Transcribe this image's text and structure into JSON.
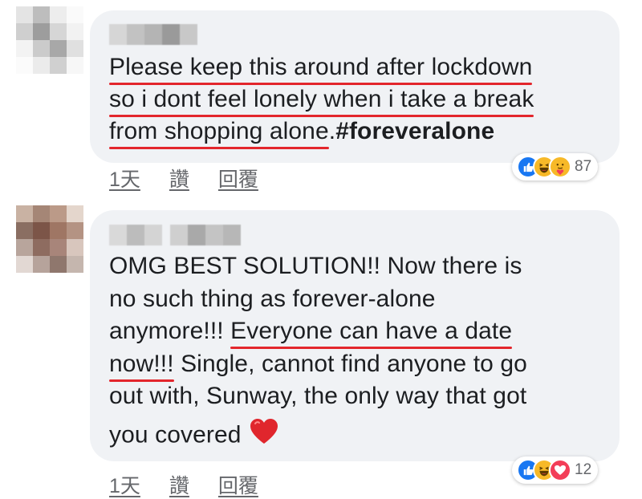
{
  "comments": [
    {
      "lines": [
        [
          {
            "text": "Please keep this around after lockdown",
            "u": true
          }
        ],
        [
          {
            "text": "so i dont feel lonely when i take a break",
            "u": true
          }
        ],
        [
          {
            "text": "from shopping alone",
            "u": true
          },
          {
            "text": ".",
            "u": false
          },
          {
            "text": "#foreveralone",
            "u": false,
            "tag": true
          }
        ]
      ],
      "actions": {
        "time": "1天",
        "like": "讚",
        "reply": "回覆"
      },
      "reactions": {
        "icons": [
          "like-icon",
          "haha-icon",
          "care-icon"
        ],
        "count": "87"
      }
    },
    {
      "lines": [
        [
          {
            "text": "OMG BEST SOLUTION!! Now there is",
            "u": false
          }
        ],
        [
          {
            "text": "no such thing as forever-alone",
            "u": false
          }
        ],
        [
          {
            "text": "anymore!!! ",
            "u": false
          },
          {
            "text": "Everyone can have a date",
            "u": true
          }
        ],
        [
          {
            "text": "now!!!",
            "u": true
          },
          {
            "text": " Single, cannot find anyone to go",
            "u": false
          }
        ],
        [
          {
            "text": "out with, Sunway, the only way that got",
            "u": false
          }
        ],
        [
          {
            "text": "you covered",
            "u": false
          }
        ]
      ],
      "actions": {
        "time": "1天",
        "like": "讚",
        "reply": "回覆"
      },
      "reactions": {
        "icons": [
          "like-icon",
          "haha-icon",
          "love-icon"
        ],
        "count": "12"
      }
    }
  ],
  "colors": {
    "underline": "#e3262c",
    "bubble": "#f0f2f5",
    "link": "#65676b",
    "like": "#1877f2"
  }
}
